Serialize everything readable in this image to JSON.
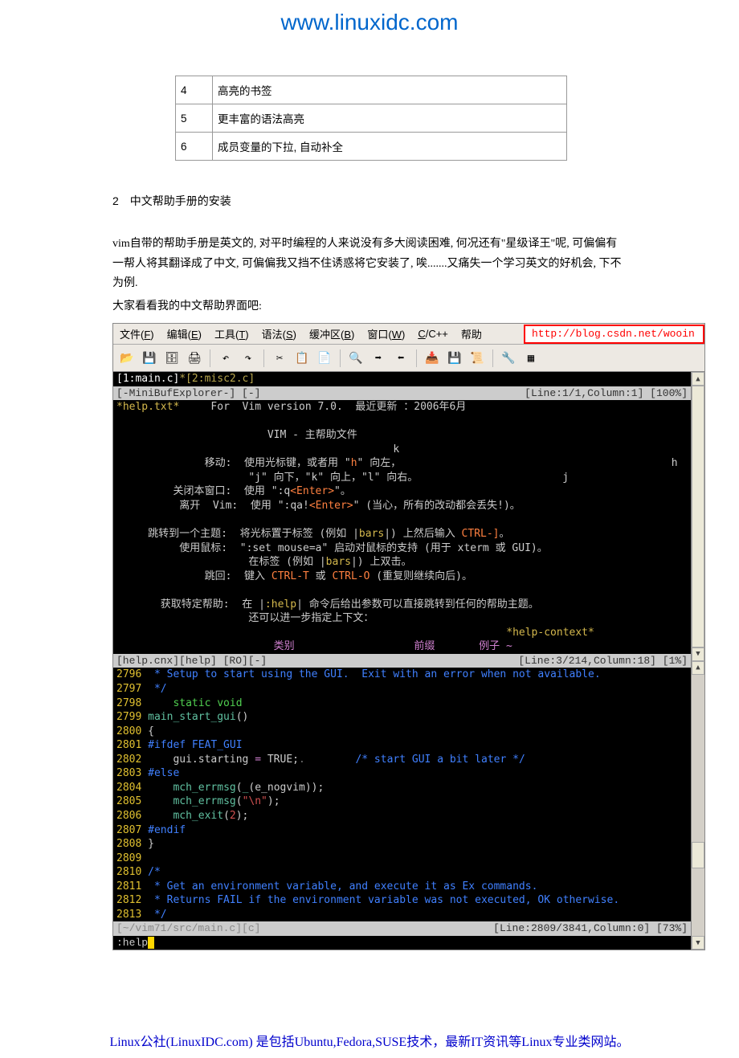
{
  "header": {
    "url": "www.linuxidc.com"
  },
  "table": {
    "rows": [
      {
        "n": "4",
        "desc": "高亮的书签"
      },
      {
        "n": "5",
        "desc": "更丰富的语法高亮"
      },
      {
        "n": "6",
        "desc": "成员变量的下拉, 自动补全"
      }
    ]
  },
  "section": {
    "num": "2",
    "title": "中文帮助手册的安装"
  },
  "paragraphs": {
    "p1": "vim自带的帮助手册是英文的, 对平时编程的人来说没有多大阅读困难, 何况还有\"星级译王\"呢, 可偏偏有一帮人将其翻译成了中文, 可偏偏我又挡不住诱惑将它安装了, 唉.......又痛失一个学习英文的好机会, 下不为例.",
    "p2": "大家看看我的中文帮助界面吧:"
  },
  "editor": {
    "menus": {
      "file": "文件(F)",
      "edit": "编辑(E)",
      "tools": "工具(T)",
      "syntax": "语法(S)",
      "buffers": "缓冲区(B)",
      "window": "窗口(W)",
      "ccpp": "C/C++",
      "help": "帮助"
    },
    "url_field": "http://blog.csdn.net/wooin",
    "tabs": {
      "active": "[1:main.c]",
      "inactive": "*[2:misc2.c]"
    },
    "minibuf": {
      "left": "[-MiniBufExplorer-] [-]",
      "right": "[Line:1/1,Column:1] [100%]"
    },
    "help": {
      "l1_tag": "*help.txt*",
      "l1_txt": "     For  Vim version 7.0.  最近更新 ：2006年6月",
      "l2": "                        VIM - 主帮助文件",
      "l3a": "              移动:  使用光标键，或者用 \"",
      "l3b": "\" 向左，",
      "l3k": "                                            k",
      "l3hl": "                                           h   l",
      "l4": "                     \"j\" 向下，\"k\" 向上，\"l\" 向右。                       j",
      "l5a": "         关闭本窗口:  使用 \":q",
      "l5b": "\"。",
      "l6a": "          离开  Vim:  使用 \":qa!",
      "l6b": "\" (当心，所有的改动都会丢失!)。",
      "l7a": "     跳转到一个主题:  将光标置于标签 (例如 |",
      "l7b": "|) 上然后输入 ",
      "l7c": "。",
      "l8a": "          使用鼠标:  \":set mouse=a\" 启动对鼠标的支持 (用于 xterm 或 GUI)。",
      "l9a": "                     在标签 (例如 |",
      "l9b": "|) 上双击。",
      "l10a": "              跳回:  键入 ",
      "l10b": " 或 ",
      "l10c": " (重复则继续向后)。",
      "l11a": "       获取特定帮助:  在 |",
      "l11b": "| 命令后给出参数可以直接跳转到任何的帮助主题。",
      "l12": "                     还可以进一步指定上下文：",
      "l13": "                                                              *help-context*",
      "l14a": "                         类别",
      "l14b": "                   前缀",
      "l14c": "       例子 ~"
    },
    "help_status": {
      "left": "[help.cnx][help] [RO][-]",
      "right": "[Line:3/214,Column:18] [1%]"
    },
    "code": {
      "lines": [
        {
          "n": "2796",
          "t": "  * Setup to start using the GUI.  Exit with an error when not available.",
          "cls": "c-cmt"
        },
        {
          "n": "2797",
          "t": "  */",
          "cls": "c-cmt"
        },
        {
          "n": "2798",
          "t": "     static void",
          "cls": "c-type"
        },
        {
          "n": "2799",
          "html": " <span class='c-fn'>main_start_gui</span>()"
        },
        {
          "n": "2800",
          "t": " {"
        },
        {
          "n": "2801",
          "html": " <span class='c-pre'>#ifdef FEAT_GUI</span>"
        },
        {
          "n": "2802",
          "html": "     gui.starting <span class='c-pink'>=</span> TRUE;<span class='c-dim'>.</span>        <span class='c-cmt'>/* start GUI a bit later */</span>"
        },
        {
          "n": "2803",
          "html": " <span class='c-pre'>#else</span>"
        },
        {
          "n": "2804",
          "html": "     <span class='c-fn'>mch_errmsg</span>(<span class='c-fn'>_</span>(e_nogvim));"
        },
        {
          "n": "2805",
          "html": "     <span class='c-fn'>mch_errmsg</span>(<span class='c-str'>\"\\n\"</span>);"
        },
        {
          "n": "2806",
          "html": "     <span class='c-fn'>mch_exit</span>(<span class='c-str'>2</span>);"
        },
        {
          "n": "2807",
          "html": " <span class='c-pre'>#endif</span>"
        },
        {
          "n": "2808",
          "t": " }"
        },
        {
          "n": "2809",
          "t": ""
        },
        {
          "n": "2810",
          "html": " <span class='c-cmt'>/*</span>"
        },
        {
          "n": "2811",
          "html": "  <span class='c-cmt'>* Get an environment variable, and execute it as Ex commands.</span>"
        },
        {
          "n": "2812",
          "html": "  <span class='c-cmt'>* Returns FAIL if the environment variable was not executed, OK otherwise.</span>"
        },
        {
          "n": "2813",
          "html": "  <span class='c-cmt'>*/</span>"
        }
      ]
    },
    "code_status": {
      "left": "[~/vim71/src/main.c][c]",
      "right": "[Line:2809/3841,Column:0] [73%]"
    },
    "cmdline": ":help"
  },
  "footer": "Linux公社(LinuxIDC.com) 是包括Ubuntu,Fedora,SUSE技术，最新IT资讯等Linux专业类网站。"
}
